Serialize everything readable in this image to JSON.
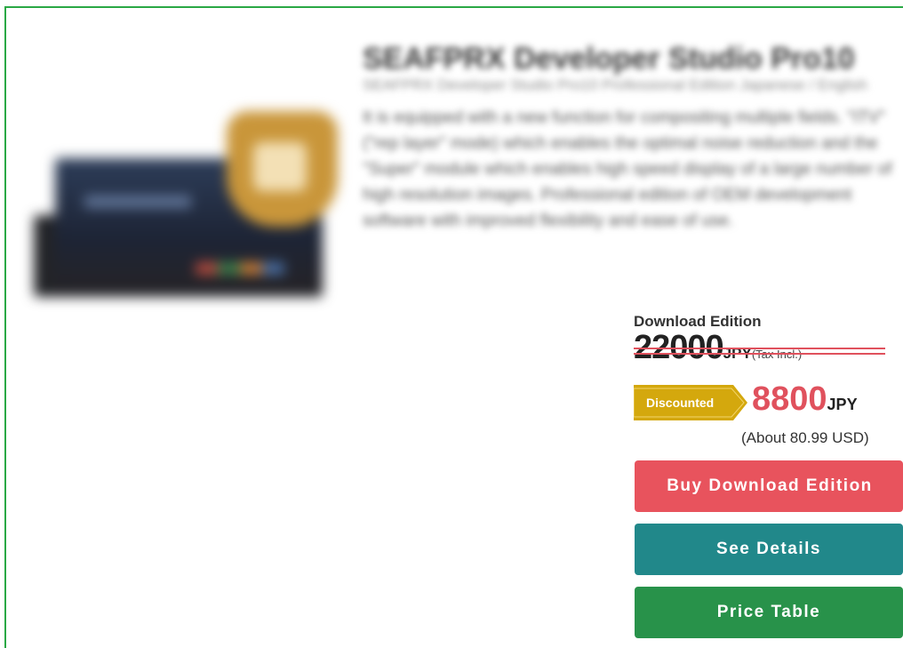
{
  "product": {
    "title": "SEAFPRX Developer Studio Pro10",
    "subtitle": "SEAFPRX Developer Studio Pro10 Professional Edition Japanese / English",
    "description": "It is equipped with a new function for compositing multiple fields. \"ITV\" (\"rep layer\" mode) which enables the optimal noise reduction and the \"Super\" module which enables high speed display of a large number of high resolution images. Professional edition of OEM development software with improved flexibility and ease of use."
  },
  "pricing": {
    "edition_label": "Download Edition",
    "original_amount": "22000",
    "original_currency": "JPY",
    "tax_note": "(Tax Incl.)",
    "discount_badge": "Discounted",
    "sale_amount": "8800",
    "sale_currency": "JPY",
    "usd_note": "(About 80.99 USD)"
  },
  "buttons": {
    "buy": "Buy Download Edition",
    "details": "See Details",
    "price_table": "Price Table"
  },
  "colors": {
    "frame_border": "#2aa845",
    "sale_red": "#e0515d",
    "discount_gold": "#d4a80d",
    "buy_button": "#e8535d",
    "details_button": "#21888a",
    "price_table_button": "#28924a"
  }
}
